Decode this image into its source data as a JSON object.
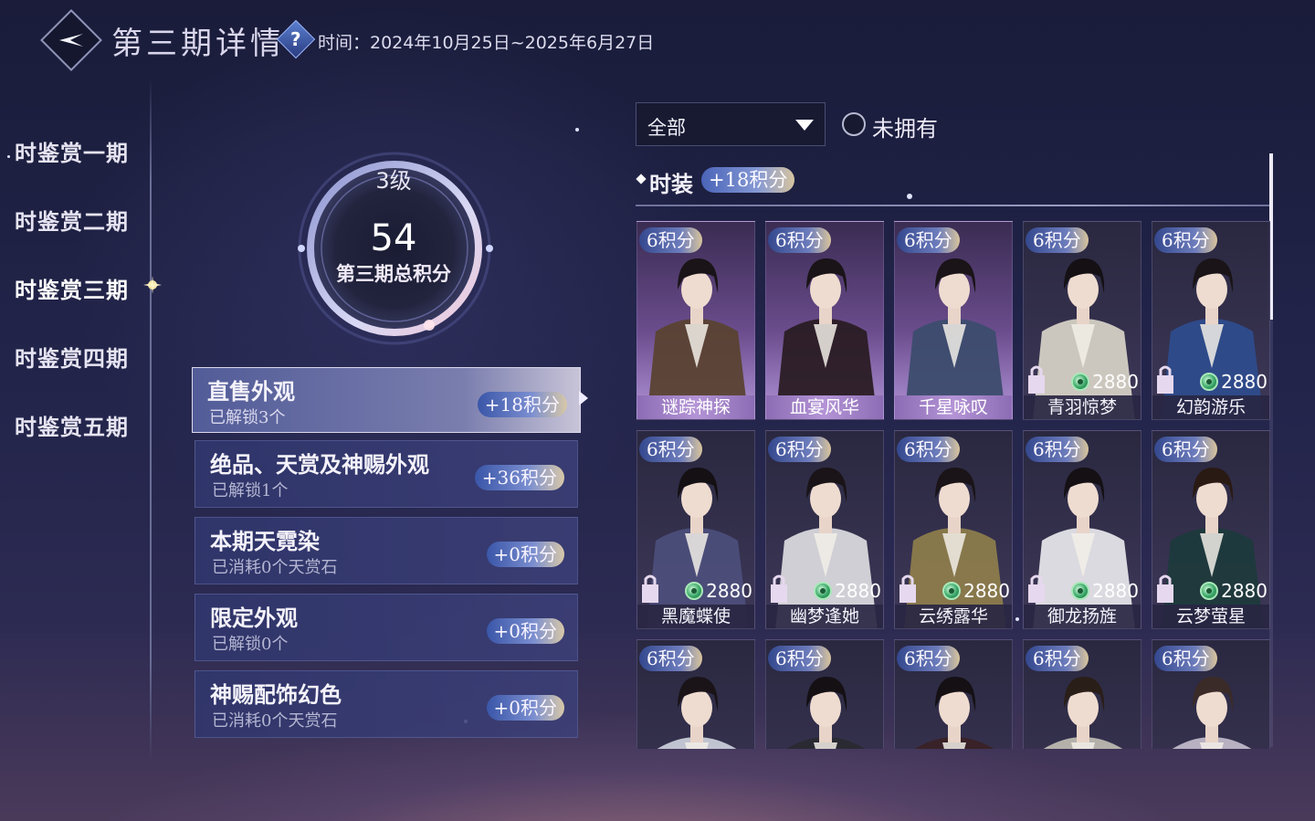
{
  "header": {
    "title": "第三期详情",
    "help_glyph": "?",
    "time_text": "时间：2024年10月25日~2025年6月27日"
  },
  "nav": {
    "items": [
      {
        "label": "时鉴赏一期"
      },
      {
        "label": "时鉴赏二期"
      },
      {
        "label": "时鉴赏三期",
        "active": true
      },
      {
        "label": "时鉴赏四期"
      },
      {
        "label": "时鉴赏五期"
      }
    ]
  },
  "score": {
    "level": "3级",
    "total": "54",
    "caption": "第三期总积分"
  },
  "categories": [
    {
      "title": "直售外观",
      "sub": "已解锁3个",
      "badge": "+18积分",
      "active": true
    },
    {
      "title": "绝品、天赏及神赐外观",
      "sub": "已解锁1个",
      "badge": "+36积分"
    },
    {
      "title": "本期天霓染",
      "sub": "已消耗0个天赏石",
      "badge": "+0积分"
    },
    {
      "title": "限定外观",
      "sub": "已解锁0个",
      "badge": "+0积分"
    },
    {
      "title": "神赐配饰幻色",
      "sub": "已消耗0个天赏石",
      "badge": "+0积分"
    }
  ],
  "filter": {
    "selected": "全部",
    "not_owned_label": "未拥有"
  },
  "section": {
    "title": "时装",
    "badge": "+18积分"
  },
  "colors": {
    "accent_badge": "#6c7cbc",
    "owned_card": "#9a7cc0",
    "background": "#22244a"
  },
  "cards": [
    {
      "points": "6积分",
      "name": "谜踪神探",
      "owned": true,
      "price": ""
    },
    {
      "points": "6积分",
      "name": "血宴风华",
      "owned": true,
      "price": ""
    },
    {
      "points": "6积分",
      "name": "千星咏叹",
      "owned": true,
      "price": ""
    },
    {
      "points": "6积分",
      "name": "青羽惊梦",
      "owned": false,
      "price": "2880"
    },
    {
      "points": "6积分",
      "name": "幻韵游乐",
      "owned": false,
      "price": "2880"
    },
    {
      "points": "6积分",
      "name": "黑魔蝶使",
      "owned": false,
      "price": "2880"
    },
    {
      "points": "6积分",
      "name": "幽梦逢她",
      "owned": false,
      "price": "2880"
    },
    {
      "points": "6积分",
      "name": "云绣露华",
      "owned": false,
      "price": "2880"
    },
    {
      "points": "6积分",
      "name": "御龙扬旌",
      "owned": false,
      "price": "2880"
    },
    {
      "points": "6积分",
      "name": "云梦萤星",
      "owned": false,
      "price": "2880"
    },
    {
      "points": "6积分",
      "name": "",
      "owned": false,
      "price": ""
    },
    {
      "points": "6积分",
      "name": "",
      "owned": false,
      "price": ""
    },
    {
      "points": "6积分",
      "name": "",
      "owned": false,
      "price": ""
    },
    {
      "points": "6积分",
      "name": "",
      "owned": false,
      "price": ""
    },
    {
      "points": "6积分",
      "name": "",
      "owned": false,
      "price": ""
    }
  ]
}
